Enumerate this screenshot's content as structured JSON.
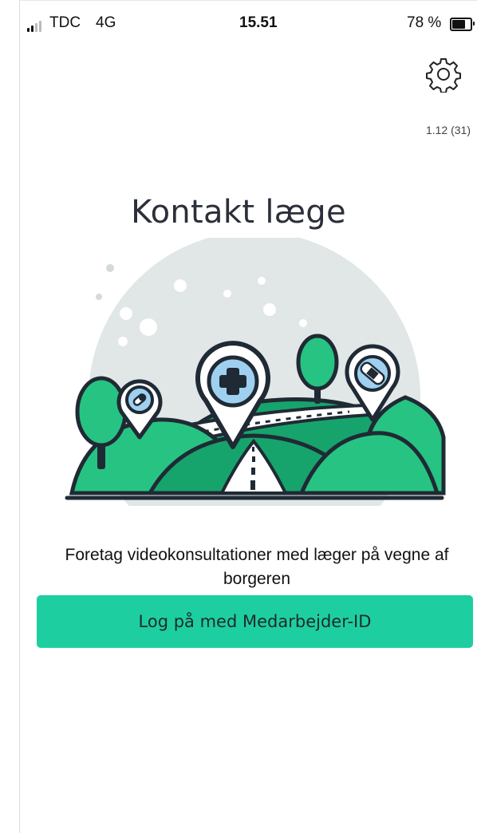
{
  "status_bar": {
    "carrier": "TDC",
    "network": "4G",
    "time": "15.51",
    "battery_percent": "78 %",
    "battery_level": 0.78,
    "signal_bars": 2
  },
  "header": {
    "settings_icon": "gear-icon",
    "version": "1.12 (31)"
  },
  "main": {
    "title": "Kontakt læge",
    "illustration_icons": [
      "pill-pin-icon",
      "medical-cross-pin-icon",
      "bandage-pin-icon"
    ],
    "description": "Foretag videokonsultationer med læger på vegne af borgeren",
    "login_button_label": "Log på med Medarbejder-ID"
  },
  "colors": {
    "accent": "#1dcfa0",
    "hill_green": "#27c382",
    "hill_dark": "#16a46c",
    "backdrop": "#e1e6e7",
    "pin_blue": "#9fd0f0",
    "outline": "#1f2a34"
  }
}
